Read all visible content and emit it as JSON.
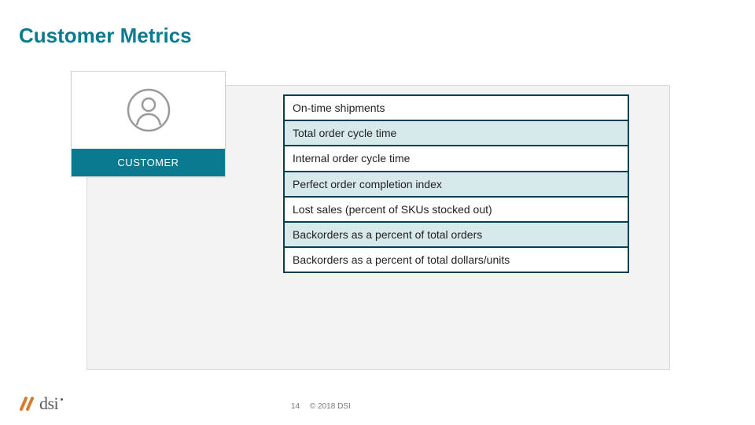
{
  "title": "Customer Metrics",
  "card": {
    "label": "CUSTOMER"
  },
  "metrics": [
    {
      "text": "On-time shipments",
      "shaded": false
    },
    {
      "text": "Total order cycle time",
      "shaded": true
    },
    {
      "text": "Internal order cycle time",
      "shaded": false
    },
    {
      "text": "Perfect order completion index",
      "shaded": true
    },
    {
      "text": "Lost sales (percent of SKUs stocked out)",
      "shaded": false
    },
    {
      "text": "Backorders as a percent of total orders",
      "shaded": true
    },
    {
      "text": "Backorders as a percent of total dollars/units",
      "shaded": false
    }
  ],
  "footer": {
    "page": "14",
    "copyright": "© 2018 DSI"
  },
  "logo": {
    "text": "dsi"
  }
}
